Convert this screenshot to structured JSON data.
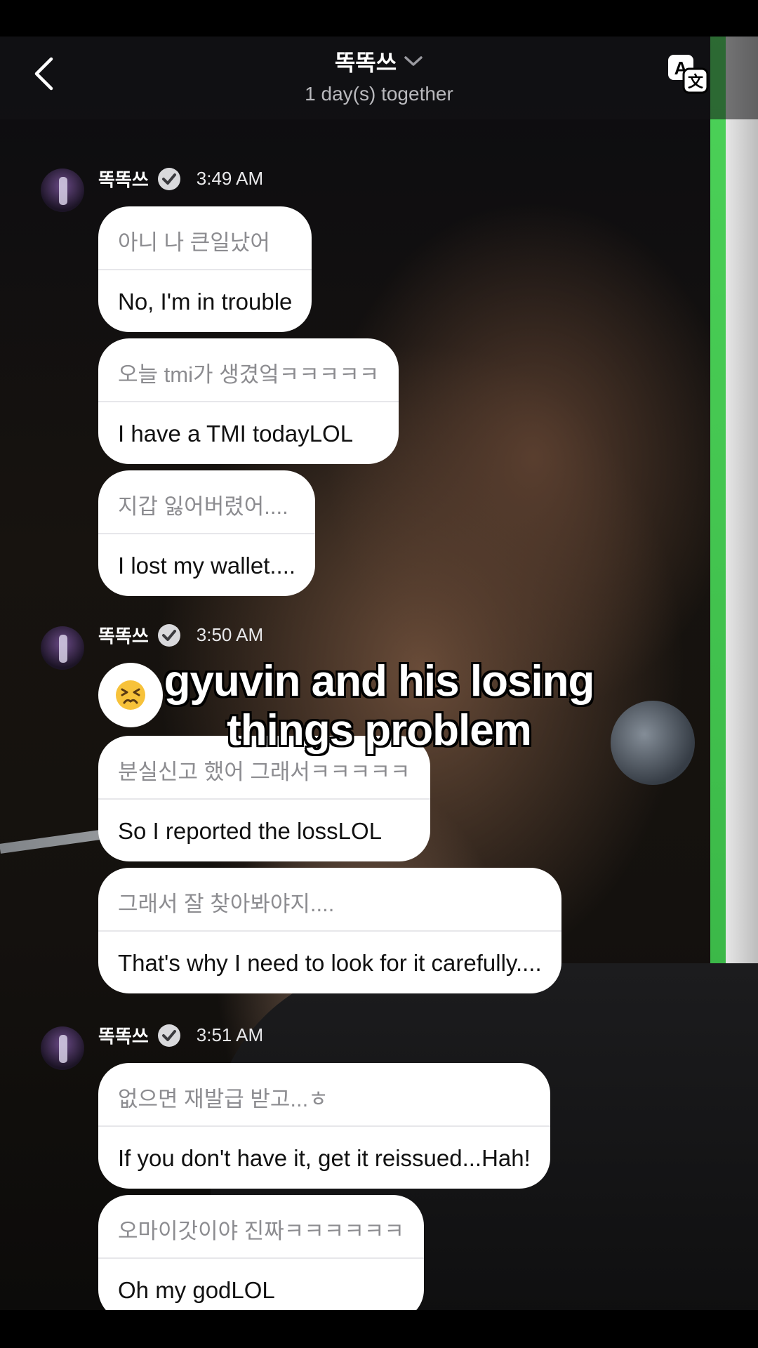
{
  "header": {
    "title": "똑똑쓰",
    "subtitle": "1 day(s) together"
  },
  "overlay_caption": "gyuvin and his losing things problem",
  "groups": [
    {
      "sender": "똑똑쓰",
      "time": "3:49 AM",
      "messages": [
        {
          "original": "아니 나 큰일났어",
          "translation": "No, I'm in trouble"
        },
        {
          "original": "오늘 tmi가 생겼엌ㅋㅋㅋㅋㅋ",
          "translation": "I have a TMI todayLOL"
        },
        {
          "original": "지갑 잃어버렸어....",
          "translation": "I lost my wallet...."
        }
      ]
    },
    {
      "sender": "똑똑쓰",
      "time": "3:50 AM",
      "emoji": "😣",
      "messages": [
        {
          "original": "분실신고 했어 그래서ㅋㅋㅋㅋㅋ",
          "translation": "So I reported the lossLOL"
        },
        {
          "original": "그래서 잘 찾아봐야지....",
          "translation": "That's why I need to look for it carefully...."
        }
      ]
    },
    {
      "sender": "똑똑쓰",
      "time": "3:51 AM",
      "messages": [
        {
          "original": "없으면 재발급 받고...ㅎ",
          "translation": "If you don't have it, get it reissued...Hah!"
        },
        {
          "original": "오마이갓이야 진짜ㅋㅋㅋㅋㅋㅋ",
          "translation": "Oh my godLOL"
        }
      ]
    }
  ],
  "colors": {
    "bubble": "#ffffff",
    "original_text": "#8c8c90",
    "translation_text": "#111111",
    "green_stripe": "#4fdc5c"
  }
}
